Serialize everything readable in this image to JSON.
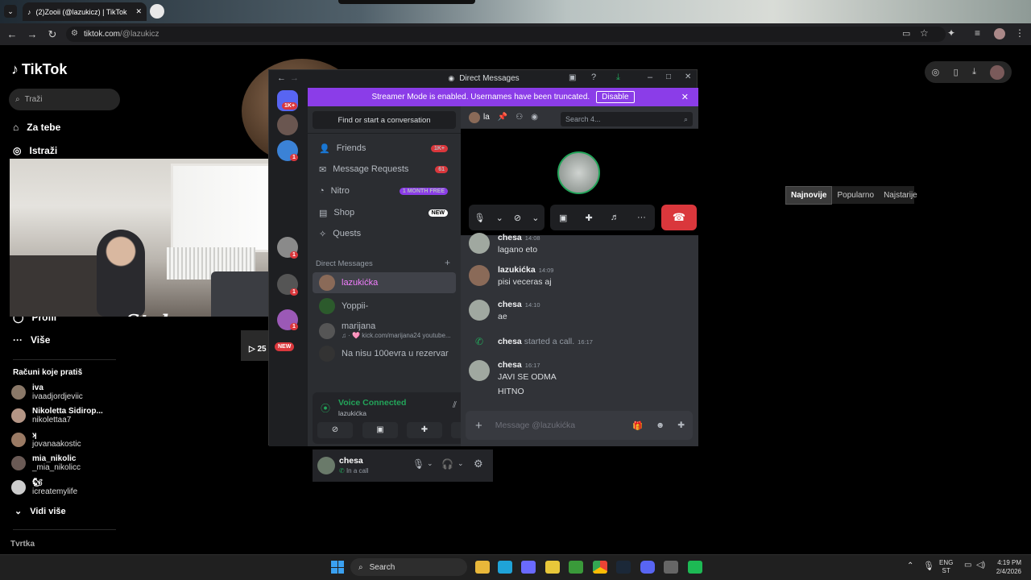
{
  "browser": {
    "tab_title": "(2)Zooii (@lazukicz) | TikTok",
    "url_host": "tiktok.com",
    "url_path": "/@lazukicz"
  },
  "tiktok": {
    "logo": "TikTok",
    "search_placeholder": "Traži",
    "nav": [
      "Za tebe",
      "Istraži",
      "Profil",
      "Više"
    ],
    "following_title": "Računi koje pratiš",
    "following": [
      {
        "name": "iva",
        "handle": "ivaadjordjeviic"
      },
      {
        "name": "Nikoletta Sidirop...",
        "handle": "nikolettaa7"
      },
      {
        "name": "ʞ",
        "handle": "jovanaakostic"
      },
      {
        "name": "mia_nikolic",
        "handle": "_mia_nikolicc"
      },
      {
        "name": "🐿",
        "handle": "icreatemylife"
      }
    ],
    "see_more": "Vidi više",
    "footer": "Tvrtka",
    "sort": [
      "Najnovije",
      "Popularno",
      "Najstarije"
    ],
    "play_count": "25"
  },
  "webcam": {
    "overlay_logo": "Stake"
  },
  "discord": {
    "window_title": "Direct Messages",
    "streamer_msg": "Streamer Mode is enabled. Usernames have been truncated.",
    "disable_label": "Disable",
    "server_badges": [
      "1K+",
      "1",
      "1",
      "1",
      "1",
      "1",
      "1"
    ],
    "new_badge": "NEW",
    "find_conv": "Find or start a conversation",
    "menu": [
      {
        "label": "Friends",
        "badge": "1K+",
        "bg": "#da373c"
      },
      {
        "label": "Message Requests",
        "badge": "61",
        "bg": "#da373c"
      },
      {
        "label": "Nitro",
        "badge": "1 MONTH FREE",
        "bg": "#8b3de8"
      },
      {
        "label": "Shop",
        "badge": "NEW",
        "bg": "#ffffff"
      },
      {
        "label": "Quests",
        "badge": "",
        "bg": ""
      }
    ],
    "dm_header": "Direct Messages",
    "dms": [
      {
        "name": "lazukićka",
        "sub": ""
      },
      {
        "name": "Yoppii-",
        "sub": ""
      },
      {
        "name": "marijana",
        "sub": "♫ · 🩷 kick.com/marijana24 youtube..."
      },
      {
        "name": "Na nisu 100evra u rezervar",
        "sub": ""
      }
    ],
    "voice": {
      "status": "Voice Connected",
      "channel": "lazukićka"
    },
    "user": {
      "name": "chesa",
      "status": "In a call"
    },
    "chat_name": "la",
    "search_placeholder": "Search 4...",
    "messages": [
      {
        "author": "chesa",
        "time": "14:08",
        "lines": [
          "lagano eto"
        ]
      },
      {
        "author": "lazukićka",
        "time": "14:09",
        "lines": [
          "pisi veceras aj"
        ]
      },
      {
        "author": "chesa",
        "time": "14:10",
        "lines": [
          "ae"
        ]
      },
      {
        "author": "chesa",
        "time": "16:17",
        "lines": [
          "JAVI SE ODMA",
          "HITNO"
        ]
      }
    ],
    "call_event": {
      "author": "chesa",
      "text": "started a call.",
      "time": "16:17"
    },
    "input_placeholder": "Message @lazukićka"
  },
  "taskbar": {
    "search": "Search",
    "lang1": "ENG",
    "lang2": "ST",
    "time": "4:19 PM",
    "date": "2/4/2026"
  }
}
